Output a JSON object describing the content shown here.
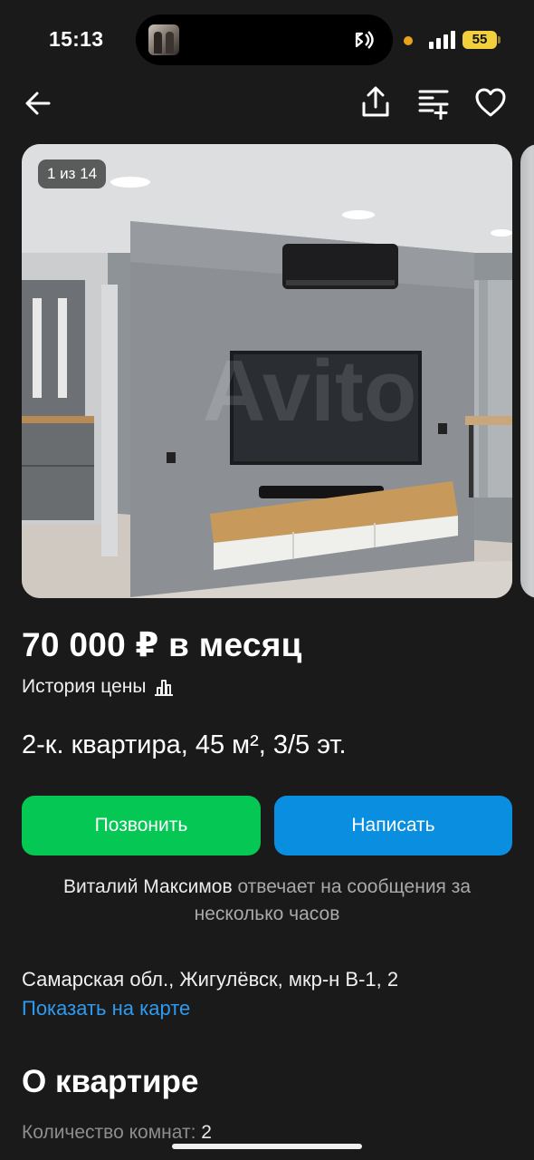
{
  "status_bar": {
    "time": "15:13",
    "battery": "55"
  },
  "nav": {
    "icons": [
      "back-arrow-icon",
      "share-icon",
      "compare-icon",
      "favorite-heart-icon"
    ]
  },
  "gallery": {
    "counter": "1 из 14",
    "watermark": "Avito"
  },
  "listing": {
    "price": "70 000 ₽ в месяц",
    "price_history": "История цены",
    "title": "2-к. квартира, 45 м², 3/5 эт."
  },
  "actions": {
    "call_label": "Позвонить",
    "write_label": "Написать",
    "call_color": "#04c754",
    "write_color": "#0a8fe0"
  },
  "seller": {
    "name": "Виталий Максимов",
    "response_text": "отвечает на сообщения за несколько часов"
  },
  "location": {
    "address": "Самарская обл., Жигулёвск, мкр-н В-1, 2",
    "map_link": "Показать на карте"
  },
  "about": {
    "title": "О квартире",
    "rooms_label": "Количество комнат:",
    "rooms_value": "2"
  },
  "colors": {
    "background": "#1a1a1a",
    "link": "#2e9bf0"
  }
}
